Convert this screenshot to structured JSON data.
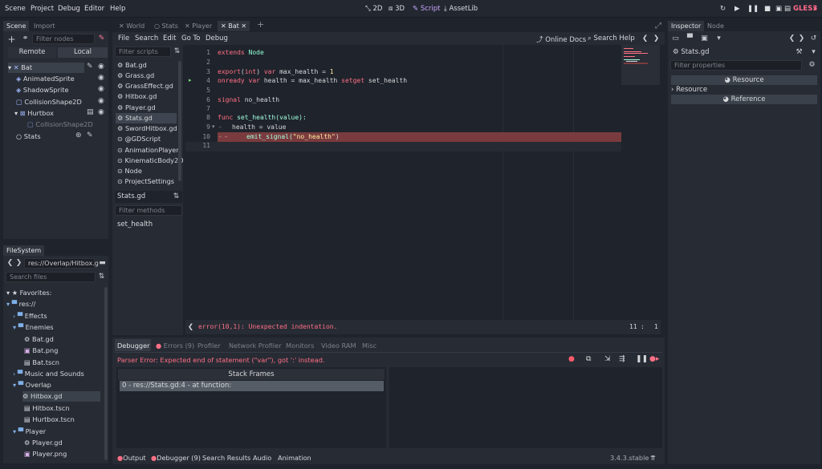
{
  "menu": [
    "Scene",
    "Project",
    "Debug",
    "Editor",
    "Help"
  ],
  "workspaces": {
    "w2d": "2D",
    "w3d": "3D",
    "script": "Script",
    "assetlib": "AssetLib"
  },
  "renderer": "GLES3",
  "scene_dock": {
    "tabs": [
      "Scene",
      "Import"
    ],
    "filter_placeholder": "Filter nodes",
    "remote": "Remote",
    "local": "Local",
    "nodes": [
      "Bat",
      "AnimatedSprite",
      "ShadowSprite",
      "CollisionShape2D",
      "Hurtbox",
      "CollisionShape2D",
      "Stats"
    ]
  },
  "filesystem": {
    "tab": "FileSystem",
    "path": "res://Overlap/Hitbox.g",
    "search_placeholder": "Search files",
    "items": [
      "Favorites:",
      "res://",
      "Effects",
      "Enemies",
      "Bat.gd",
      "Bat.png",
      "Bat.tscn",
      "Music and Sounds",
      "Overlap",
      "Hitbox.gd",
      "Hitbox.tscn",
      "Hurtbox.tscn",
      "Player",
      "Player.gd",
      "Player.png"
    ]
  },
  "editor_tabs": [
    "World",
    "Stats",
    "Player",
    "Bat"
  ],
  "script_menu": [
    "File",
    "Search",
    "Edit",
    "Go To",
    "Debug"
  ],
  "online_docs": "Online Docs",
  "search_help": "Search Help",
  "filter_scripts_placeholder": "Filter scripts",
  "scripts": [
    "Bat.gd",
    "Grass.gd",
    "GrassEffect.gd",
    "Hitbox.gd",
    "Player.gd",
    "Stats.gd",
    "SwordHitbox.gd",
    "@GDScript",
    "AnimationPlayer",
    "KinematicBody2D",
    "Node",
    "ProjectSettings"
  ],
  "current_script": "Stats.gd",
  "filter_methods_placeholder": "Filter methods",
  "methods": [
    "set_health"
  ],
  "code": {
    "lines": [
      "1",
      "2",
      "3",
      "4",
      "5",
      "6",
      "7",
      "8",
      "9",
      "10",
      "11"
    ],
    "l1a": "extends",
    "l1b": "Node",
    "l3a": "export",
    "l3b": "(",
    "l3c": "int",
    "l3d": ") ",
    "l3e": "var",
    "l3f": " max_health = ",
    "l3g": "1",
    "l4a": "onready",
    "l4b": " ",
    "l4c": "var",
    "l4d": " health = max_health ",
    "l4e": "setget",
    "l4f": " set_health",
    "l6a": "signal",
    "l6b": " no_health",
    "l8a": "func",
    "l8b": " set_health(value):",
    "l9": "health = value",
    "l10a": "emit_signal(",
    "l10b": "\"no_health\"",
    "l10c": ")"
  },
  "status_error": "error(10,1): Unexpected indentation.",
  "cursor": {
    "line": "11",
    "col": "1"
  },
  "debugger": {
    "tabs": [
      "Debugger",
      "Errors (9)",
      "Profiler",
      "Network Profiler",
      "Monitors",
      "Video RAM",
      "Misc"
    ],
    "message": "Parser Error: Expected end of statement (\"var\"), got ':' instead.",
    "stack_header": "Stack Frames",
    "frame": "0 - res://Stats.gd:4 - at function:"
  },
  "bottom": {
    "output": "Output",
    "debugger": "Debugger (9)",
    "search": "Search Results",
    "audio": "Audio",
    "animation": "Animation",
    "version": "3.4.3.stable"
  },
  "inspector": {
    "tabs": [
      "Inspector",
      "Node"
    ],
    "object": "Stats.gd",
    "filter_placeholder": "Filter properties",
    "section1": "Resource",
    "section2": "Resource",
    "section3": "Reference"
  }
}
